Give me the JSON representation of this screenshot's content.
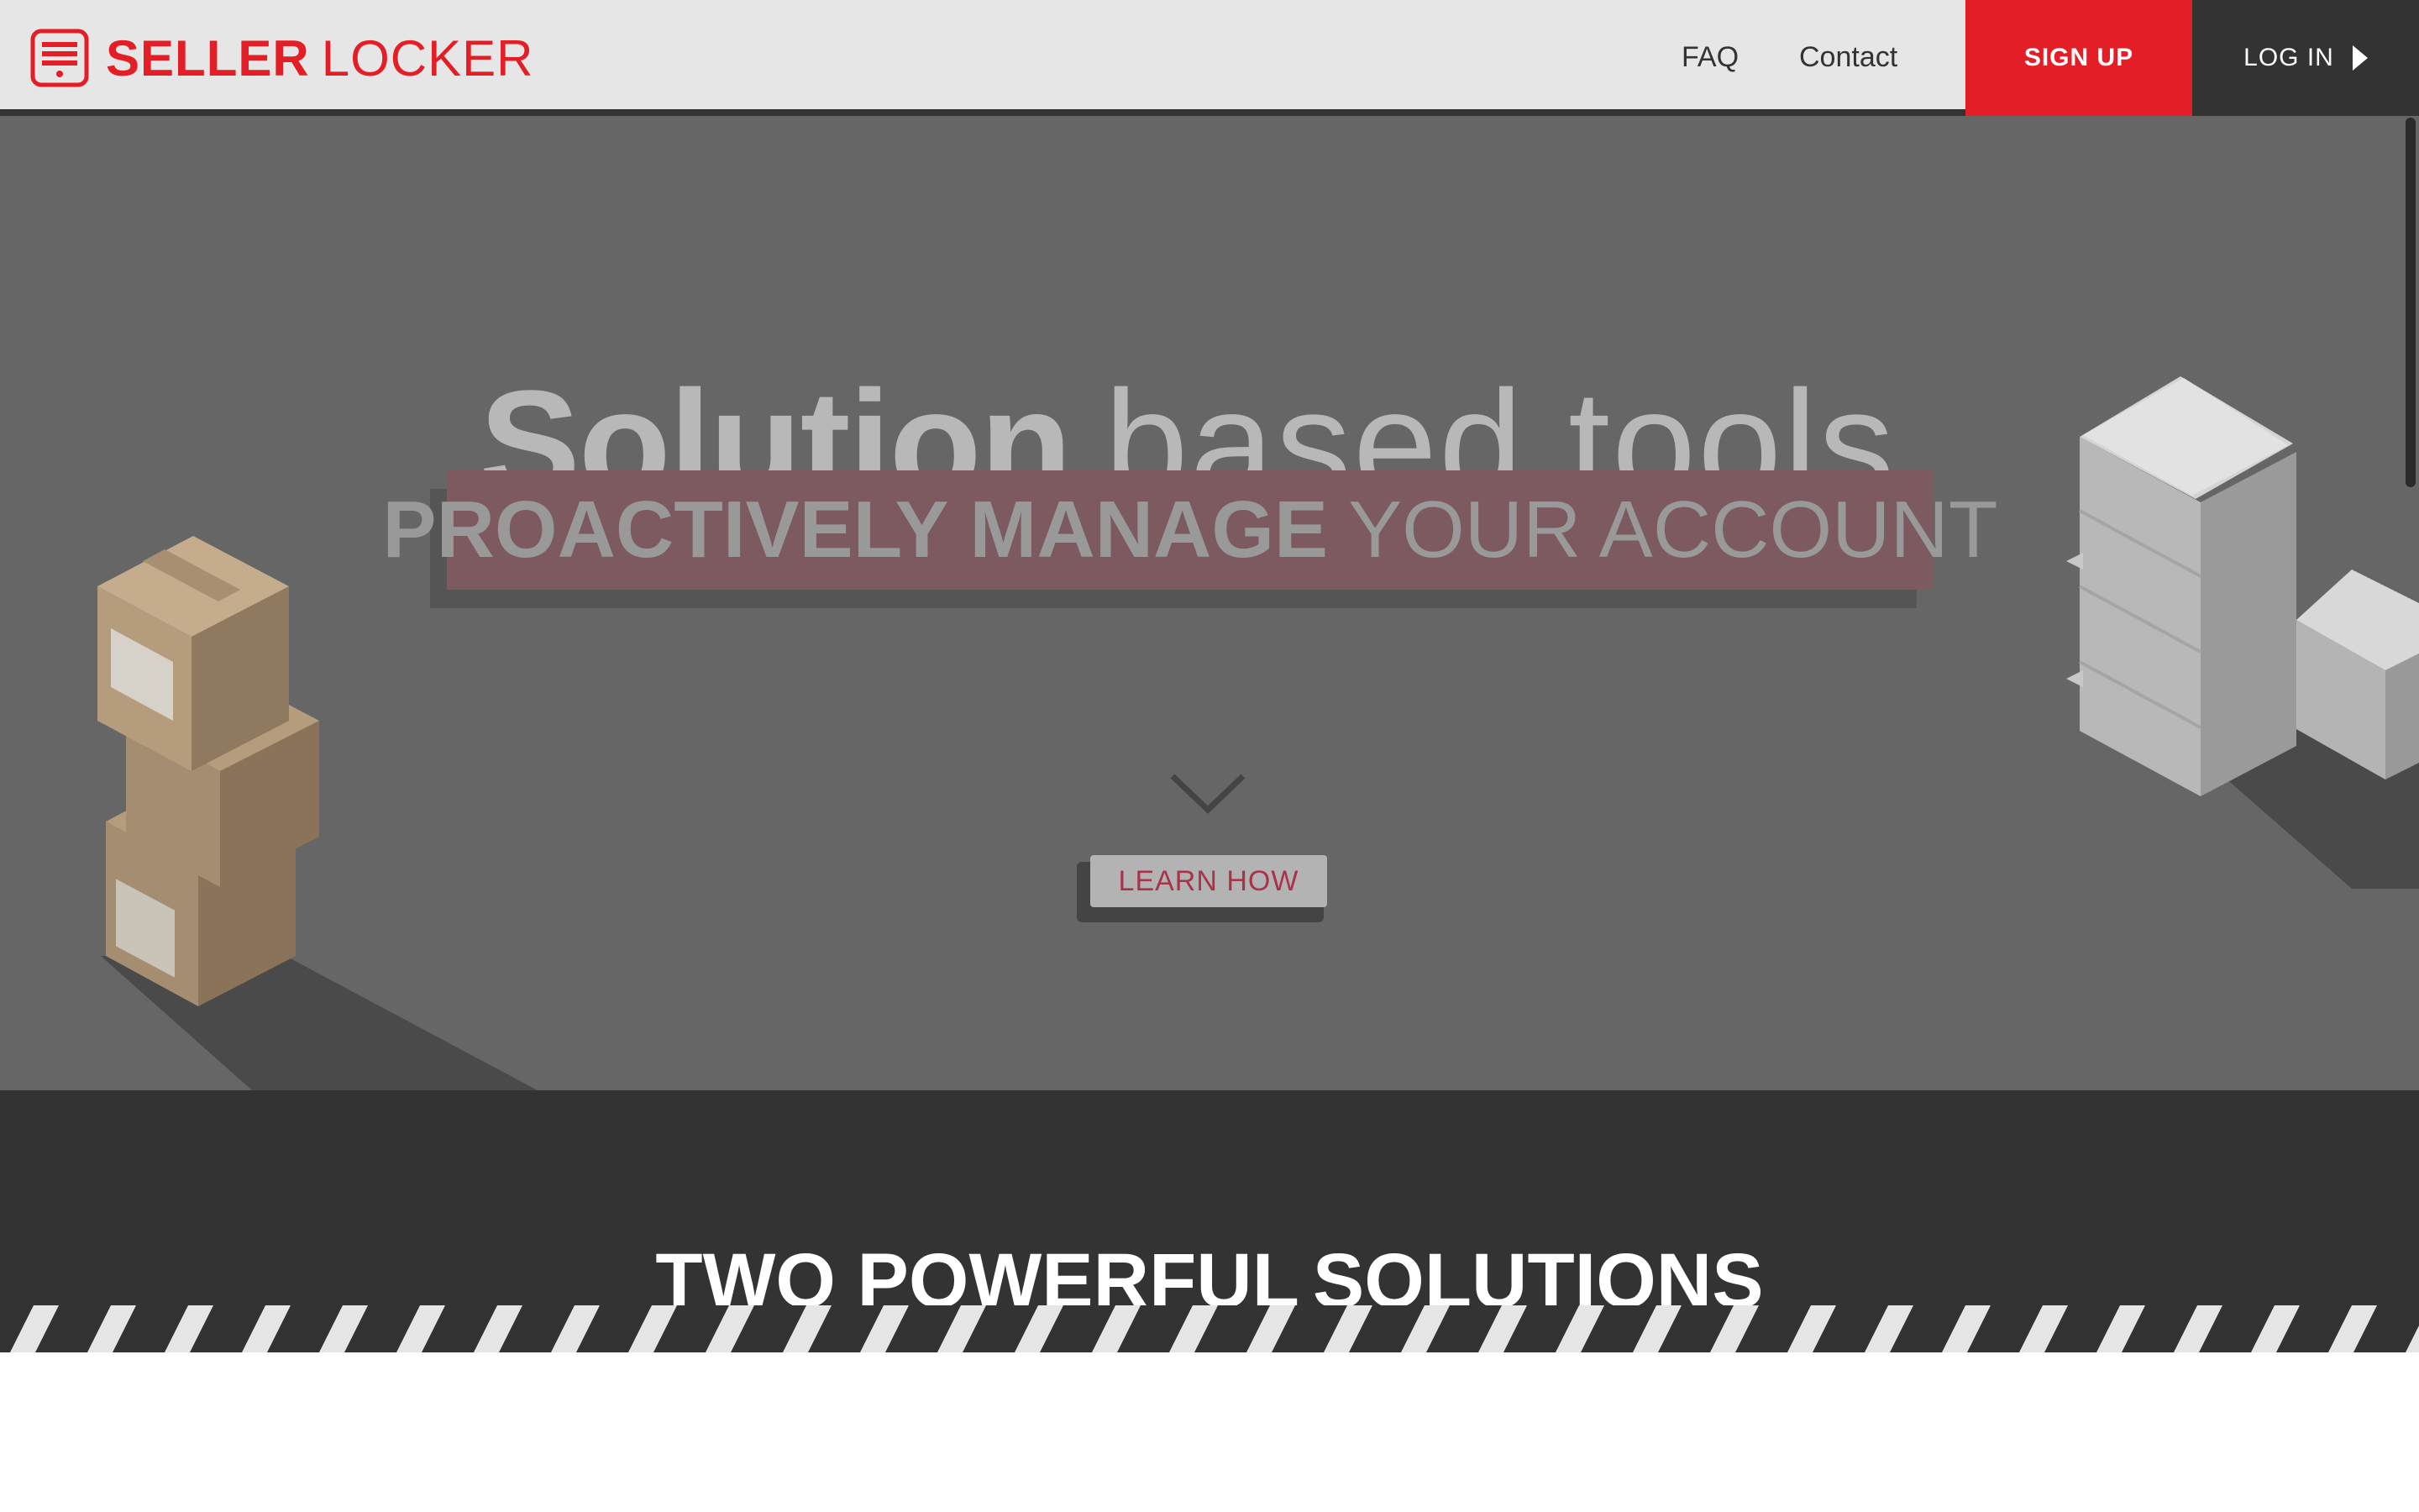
{
  "brand": {
    "name_bold": "SELLER",
    "name_light": "LOCKER",
    "color": "#e31e26"
  },
  "nav": {
    "faq": "FAQ",
    "contact": "Contact",
    "signup": "SIGN UP",
    "login": "LOG IN"
  },
  "hero": {
    "title_bold": "Solution",
    "title_light": "based tools.",
    "banner_bold": "PROACTIVELY MANAGE",
    "banner_light": "YOUR ACCOUNT",
    "cta": "LEARN HOW",
    "scroll_icon": "chevron-down-icon",
    "background": "#666666"
  },
  "solutions": {
    "title_light": "TWO POWERFUL",
    "title_bold": "SOLUTIONS"
  }
}
